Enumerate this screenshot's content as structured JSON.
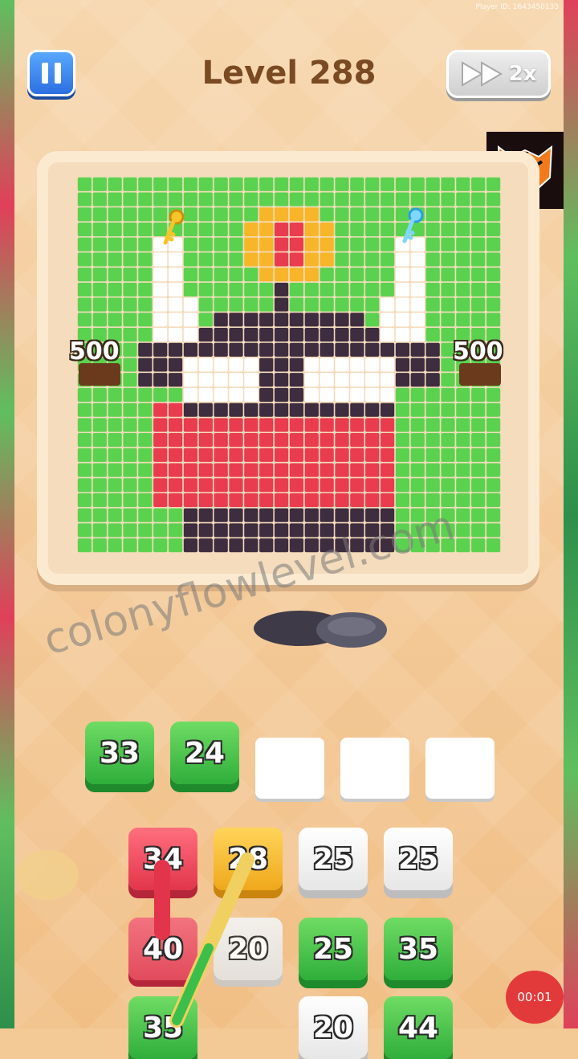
{
  "header": {
    "player_id": "Player ID: 1643450133",
    "level_title": "Level 288",
    "speed_label": "2x"
  },
  "icons": {
    "pause": "pause-icon",
    "fast_forward": "fast-forward-icon",
    "avatar": "tiger-logo",
    "key_gold": "gold-key-icon",
    "key_blue": "blue-key-icon"
  },
  "board": {
    "cols": 28,
    "rows": 25,
    "colors": {
      "green": "#5bd24f",
      "purple": "#3e2c3f",
      "white": "#ffffff",
      "red": "#ea3c4f",
      "yellow": "#f7b62a",
      "brown": "#6b3a1c"
    },
    "scores": [
      "500",
      "500"
    ]
  },
  "watermark": "colonyflowlevel.com",
  "slots": {
    "filled": [
      {
        "value": "33",
        "color": "green"
      },
      {
        "value": "24",
        "color": "green"
      }
    ],
    "empty_count": 3
  },
  "grid_rows": [
    [
      {
        "value": "34",
        "color": "red"
      },
      {
        "value": "28",
        "color": "yellow"
      },
      {
        "value": "25",
        "color": "white"
      },
      {
        "value": "25",
        "color": "white"
      }
    ],
    [
      {
        "value": "40",
        "color": "red"
      },
      {
        "value": "20",
        "color": "white"
      },
      {
        "value": "25",
        "color": "green"
      },
      {
        "value": "35",
        "color": "green"
      }
    ],
    [
      {
        "value": "35",
        "color": "green"
      },
      {
        "value": "",
        "color": "hidden"
      },
      {
        "value": "20",
        "color": "white"
      },
      {
        "value": "44",
        "color": "green"
      }
    ]
  ],
  "timer": "00:01"
}
